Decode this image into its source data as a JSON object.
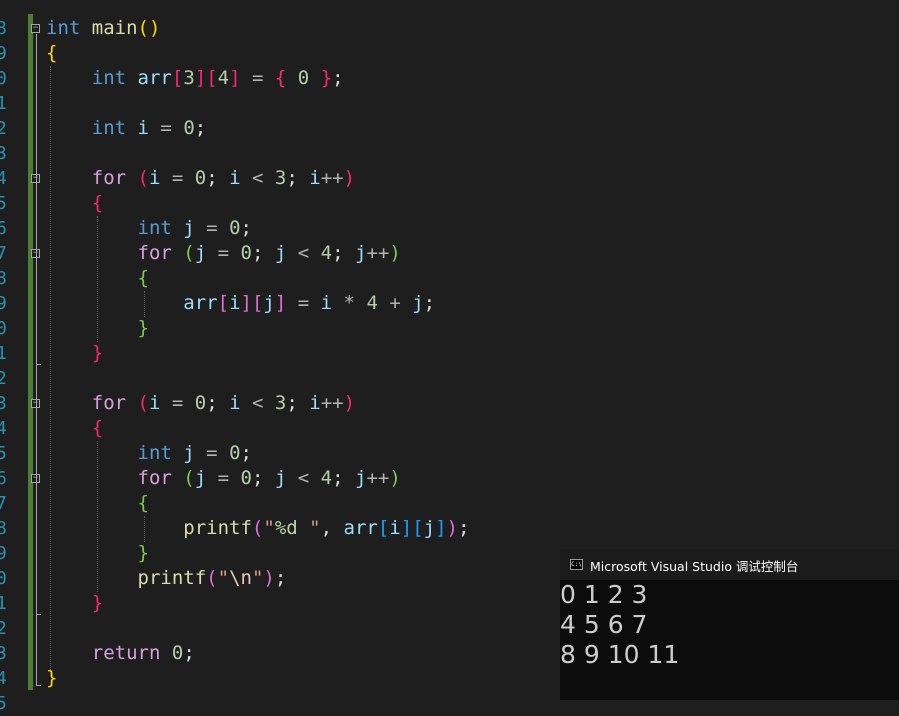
{
  "gutter": {
    "line_numbers": [
      "8",
      "9",
      "0",
      "1",
      "2",
      "3",
      "4",
      "5",
      "6",
      "7",
      "8",
      "9",
      "0",
      "1",
      "2",
      "3",
      "4",
      "5",
      "6",
      "7",
      "8",
      "9",
      "0",
      "1",
      "2",
      "3",
      "4",
      "5"
    ]
  },
  "code": {
    "lines": [
      [
        {
          "t": "int",
          "c": "kw"
        },
        {
          "t": " main",
          "c": "fn"
        },
        {
          "t": "(",
          "c": "b1"
        },
        {
          "t": ")",
          "c": "b1"
        }
      ],
      [
        {
          "t": "{",
          "c": "b1"
        }
      ],
      [
        {
          "t": "    "
        },
        {
          "t": "int",
          "c": "kw"
        },
        {
          "t": " arr",
          "c": "var"
        },
        {
          "t": "[",
          "c": "b4"
        },
        {
          "t": "3",
          "c": "num"
        },
        {
          "t": "]",
          "c": "b4"
        },
        {
          "t": "[",
          "c": "b4"
        },
        {
          "t": "4",
          "c": "num"
        },
        {
          "t": "]",
          "c": "b4"
        },
        {
          "t": " = ",
          "c": "op"
        },
        {
          "t": "{",
          "c": "b4"
        },
        {
          "t": " 0 ",
          "c": "num"
        },
        {
          "t": "}",
          "c": "b4"
        },
        {
          "t": ";"
        }
      ],
      [],
      [
        {
          "t": "    "
        },
        {
          "t": "int",
          "c": "kw"
        },
        {
          "t": " i",
          "c": "var"
        },
        {
          "t": " = ",
          "c": "op"
        },
        {
          "t": "0",
          "c": "num"
        },
        {
          "t": ";"
        }
      ],
      [],
      [
        {
          "t": "    "
        },
        {
          "t": "for",
          "c": "ctl"
        },
        {
          "t": " "
        },
        {
          "t": "(",
          "c": "b4"
        },
        {
          "t": "i",
          "c": "var"
        },
        {
          "t": " = ",
          "c": "op"
        },
        {
          "t": "0",
          "c": "num"
        },
        {
          "t": "; "
        },
        {
          "t": "i",
          "c": "var"
        },
        {
          "t": " < ",
          "c": "op"
        },
        {
          "t": "3",
          "c": "num"
        },
        {
          "t": "; "
        },
        {
          "t": "i",
          "c": "var"
        },
        {
          "t": "++",
          "c": "op"
        },
        {
          "t": ")",
          "c": "b4"
        }
      ],
      [
        {
          "t": "    "
        },
        {
          "t": "{",
          "c": "b4"
        }
      ],
      [
        {
          "t": "        "
        },
        {
          "t": "int",
          "c": "kw"
        },
        {
          "t": " j",
          "c": "var"
        },
        {
          "t": " = ",
          "c": "op"
        },
        {
          "t": "0",
          "c": "num"
        },
        {
          "t": ";"
        }
      ],
      [
        {
          "t": "        "
        },
        {
          "t": "for",
          "c": "ctl"
        },
        {
          "t": " "
        },
        {
          "t": "(",
          "c": "bg"
        },
        {
          "t": "j",
          "c": "var"
        },
        {
          "t": " = ",
          "c": "op"
        },
        {
          "t": "0",
          "c": "num"
        },
        {
          "t": "; "
        },
        {
          "t": "j",
          "c": "var"
        },
        {
          "t": " < ",
          "c": "op"
        },
        {
          "t": "4",
          "c": "num"
        },
        {
          "t": "; "
        },
        {
          "t": "j",
          "c": "var"
        },
        {
          "t": "++",
          "c": "op"
        },
        {
          "t": ")",
          "c": "bg"
        }
      ],
      [
        {
          "t": "        "
        },
        {
          "t": "{",
          "c": "bg"
        }
      ],
      [
        {
          "t": "            "
        },
        {
          "t": "arr",
          "c": "var"
        },
        {
          "t": "[",
          "c": "b2"
        },
        {
          "t": "i",
          "c": "var"
        },
        {
          "t": "]",
          "c": "b2"
        },
        {
          "t": "[",
          "c": "b2"
        },
        {
          "t": "j",
          "c": "var"
        },
        {
          "t": "]",
          "c": "b2"
        },
        {
          "t": " = ",
          "c": "op"
        },
        {
          "t": "i",
          "c": "var"
        },
        {
          "t": " * ",
          "c": "op"
        },
        {
          "t": "4",
          "c": "num"
        },
        {
          "t": " + ",
          "c": "op"
        },
        {
          "t": "j",
          "c": "var"
        },
        {
          "t": ";"
        }
      ],
      [
        {
          "t": "        "
        },
        {
          "t": "}",
          "c": "bg"
        }
      ],
      [
        {
          "t": "    "
        },
        {
          "t": "}",
          "c": "b4"
        }
      ],
      [],
      [
        {
          "t": "    "
        },
        {
          "t": "for",
          "c": "ctl"
        },
        {
          "t": " "
        },
        {
          "t": "(",
          "c": "b4"
        },
        {
          "t": "i",
          "c": "var"
        },
        {
          "t": " = ",
          "c": "op"
        },
        {
          "t": "0",
          "c": "num"
        },
        {
          "t": "; "
        },
        {
          "t": "i",
          "c": "var"
        },
        {
          "t": " < ",
          "c": "op"
        },
        {
          "t": "3",
          "c": "num"
        },
        {
          "t": "; "
        },
        {
          "t": "i",
          "c": "var"
        },
        {
          "t": "++",
          "c": "op"
        },
        {
          "t": ")",
          "c": "b4"
        }
      ],
      [
        {
          "t": "    "
        },
        {
          "t": "{",
          "c": "b4"
        }
      ],
      [
        {
          "t": "        "
        },
        {
          "t": "int",
          "c": "kw"
        },
        {
          "t": " j",
          "c": "var"
        },
        {
          "t": " = ",
          "c": "op"
        },
        {
          "t": "0",
          "c": "num"
        },
        {
          "t": ";"
        }
      ],
      [
        {
          "t": "        "
        },
        {
          "t": "for",
          "c": "ctl"
        },
        {
          "t": " "
        },
        {
          "t": "(",
          "c": "bg"
        },
        {
          "t": "j",
          "c": "var"
        },
        {
          "t": " = ",
          "c": "op"
        },
        {
          "t": "0",
          "c": "num"
        },
        {
          "t": "; "
        },
        {
          "t": "j",
          "c": "var"
        },
        {
          "t": " < ",
          "c": "op"
        },
        {
          "t": "4",
          "c": "num"
        },
        {
          "t": "; "
        },
        {
          "t": "j",
          "c": "var"
        },
        {
          "t": "++",
          "c": "op"
        },
        {
          "t": ")",
          "c": "bg"
        }
      ],
      [
        {
          "t": "        "
        },
        {
          "t": "{",
          "c": "bg"
        }
      ],
      [
        {
          "t": "            "
        },
        {
          "t": "printf",
          "c": "fn"
        },
        {
          "t": "(",
          "c": "b2"
        },
        {
          "t": "\"",
          "c": "str"
        },
        {
          "t": "%d",
          "c": "fmt"
        },
        {
          "t": " \"",
          "c": "str"
        },
        {
          "t": ", "
        },
        {
          "t": "arr",
          "c": "var"
        },
        {
          "t": "[",
          "c": "b3"
        },
        {
          "t": "i",
          "c": "var"
        },
        {
          "t": "]",
          "c": "b3"
        },
        {
          "t": "[",
          "c": "b3"
        },
        {
          "t": "j",
          "c": "var"
        },
        {
          "t": "]",
          "c": "b3"
        },
        {
          "t": ")",
          "c": "b2"
        },
        {
          "t": ";"
        }
      ],
      [
        {
          "t": "        "
        },
        {
          "t": "}",
          "c": "bg"
        }
      ],
      [
        {
          "t": "        "
        },
        {
          "t": "printf",
          "c": "fn"
        },
        {
          "t": "(",
          "c": "b2"
        },
        {
          "t": "\"",
          "c": "str"
        },
        {
          "t": "\\n",
          "c": "esc"
        },
        {
          "t": "\"",
          "c": "str"
        },
        {
          "t": ")",
          "c": "b2"
        },
        {
          "t": ";"
        }
      ],
      [
        {
          "t": "    "
        },
        {
          "t": "}",
          "c": "b4"
        }
      ],
      [],
      [
        {
          "t": "    "
        },
        {
          "t": "return",
          "c": "ctl"
        },
        {
          "t": " "
        },
        {
          "t": "0",
          "c": "num"
        },
        {
          "t": ";"
        }
      ],
      [
        {
          "t": "}",
          "c": "b1"
        }
      ]
    ]
  },
  "console": {
    "icon_text": "C:\\",
    "title": "Microsoft Visual Studio 调试控制台",
    "output": [
      "0 1 2 3",
      "4 5 6 7",
      "8 9 10 11"
    ]
  },
  "colors": {
    "editor_bg": "#1e1e1e",
    "keyword": "#569cd6",
    "control": "#d8a0df",
    "function": "#dcdcaa",
    "number": "#b5cea8",
    "variable": "#9cdcfe",
    "line_number": "#2b91af",
    "console_bg": "#0c0c0c"
  }
}
